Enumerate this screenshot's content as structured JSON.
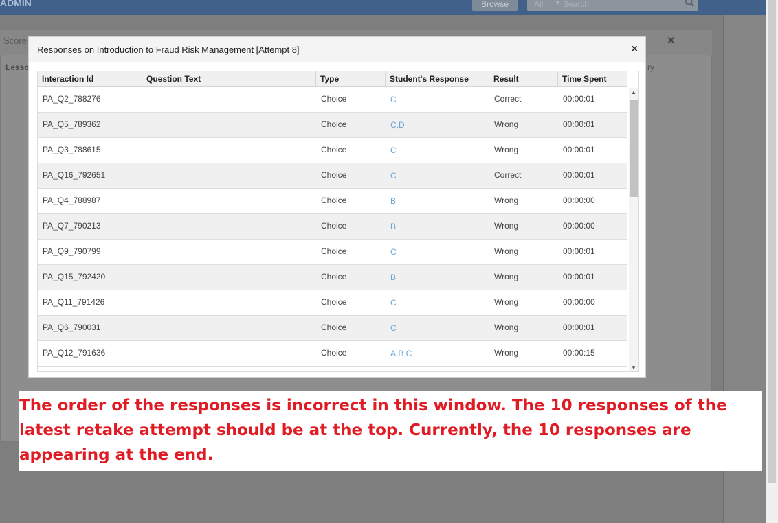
{
  "app": {
    "brand": "ADMIN",
    "browse_label": "Browse",
    "search_scope": "All",
    "search_placeholder": "Search",
    "panel_title": "Score",
    "panel_col1": "Lesso",
    "panel_col2": "ry"
  },
  "modal": {
    "title": "Responses on Introduction to Fraud Risk Management [Attempt 8]",
    "close_label": "×",
    "columns": [
      "Interaction Id",
      "Question Text",
      "Type",
      "Student's Response",
      "Result",
      "Time Spent"
    ],
    "rows": [
      {
        "id": "PA_Q2_788276",
        "question": "",
        "type": "Choice",
        "response": "C",
        "result": "Correct",
        "time": "00:00:01"
      },
      {
        "id": "PA_Q5_789362",
        "question": "",
        "type": "Choice",
        "response": "C,D",
        "result": "Wrong",
        "time": "00:00:01"
      },
      {
        "id": "PA_Q3_788615",
        "question": "",
        "type": "Choice",
        "response": "C",
        "result": "Wrong",
        "time": "00:00:01"
      },
      {
        "id": "PA_Q16_792651",
        "question": "",
        "type": "Choice",
        "response": "C",
        "result": "Correct",
        "time": "00:00:01"
      },
      {
        "id": "PA_Q4_788987",
        "question": "",
        "type": "Choice",
        "response": "B",
        "result": "Wrong",
        "time": "00:00:00"
      },
      {
        "id": "PA_Q7_790213",
        "question": "",
        "type": "Choice",
        "response": "B",
        "result": "Wrong",
        "time": "00:00:00"
      },
      {
        "id": "PA_Q9_790799",
        "question": "",
        "type": "Choice",
        "response": "C",
        "result": "Wrong",
        "time": "00:00:01"
      },
      {
        "id": "PA_Q15_792420",
        "question": "",
        "type": "Choice",
        "response": "B",
        "result": "Wrong",
        "time": "00:00:01"
      },
      {
        "id": "PA_Q11_791426",
        "question": "",
        "type": "Choice",
        "response": "C",
        "result": "Wrong",
        "time": "00:00:00"
      },
      {
        "id": "PA_Q6_790031",
        "question": "",
        "type": "Choice",
        "response": "C",
        "result": "Wrong",
        "time": "00:00:01"
      },
      {
        "id": "PA_Q12_791636",
        "question": "",
        "type": "Choice",
        "response": "A,B,C",
        "result": "Wrong",
        "time": "00:00:15"
      }
    ]
  },
  "annotation": {
    "text": "The order of the responses is incorrect in this window. The 10 responses of the latest retake attempt should be at the top. Currently, the 10 responses are appearing at the end."
  },
  "colors": {
    "accent_link": "#6aa5d3",
    "annotation_red": "#e01b24",
    "topbar": "#41618a"
  }
}
